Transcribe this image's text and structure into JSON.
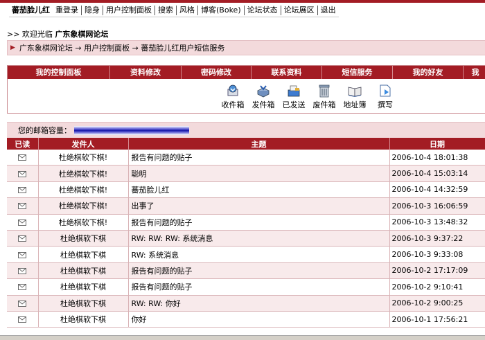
{
  "nav": {
    "user": "蕃茄脸儿红",
    "items": [
      "重登录",
      "隐身",
      "用户控制面板",
      "搜索",
      "风格",
      "博客(Boke)",
      "论坛状态",
      "论坛展区",
      "退出"
    ]
  },
  "welcome": {
    "prefix": ">> 欢迎光临",
    "forum": "广东象棋网论坛"
  },
  "breadcrumb": "广东象棋网论坛 → 用户控制面板 → 蕃茄脸儿红用户短信服务",
  "menu": [
    "我的控制面板",
    "资料修改",
    "密码修改",
    "联系资料",
    "短信服务",
    "我的好友",
    "我"
  ],
  "tools": [
    {
      "label": "收件箱",
      "icon": "inbox-icon"
    },
    {
      "label": "发件箱",
      "icon": "outbox-icon"
    },
    {
      "label": "已发送",
      "icon": "sent-icon"
    },
    {
      "label": "废件箱",
      "icon": "trash-icon"
    },
    {
      "label": "地址簿",
      "icon": "address-book-icon"
    },
    {
      "label": "撰写",
      "icon": "compose-icon"
    }
  ],
  "quota_label": "您的邮箱容量：",
  "table": {
    "headers": [
      "已读",
      "发件人",
      "主题",
      "日期"
    ],
    "rows": [
      {
        "from": "杜绝棋软下棋!",
        "subject": "报告有问题的贴子",
        "date": "2006-10-4 18:01:38"
      },
      {
        "from": "杜绝棋软下棋!",
        "subject": "聪明",
        "date": "2006-10-4 15:03:14"
      },
      {
        "from": "杜绝棋软下棋!",
        "subject": "蕃茄脸儿红",
        "date": "2006-10-4 14:32:59"
      },
      {
        "from": "杜绝棋软下棋!",
        "subject": "出事了",
        "date": "2006-10-3 16:06:59"
      },
      {
        "from": "杜绝棋软下棋!",
        "subject": "报告有问题的贴子",
        "date": "2006-10-3 13:48:32"
      },
      {
        "from": "杜绝棋软下棋",
        "subject": "RW: RW: RW: 系统消息",
        "date": "2006-10-3 9:37:22"
      },
      {
        "from": "杜绝棋软下棋",
        "subject": "RW: 系统消息",
        "date": "2006-10-3 9:33:08"
      },
      {
        "from": "杜绝棋软下棋",
        "subject": "报告有问题的贴子",
        "date": "2006-10-2 17:17:09"
      },
      {
        "from": "杜绝棋软下棋",
        "subject": "报告有问题的贴子",
        "date": "2006-10-2 9:10:41"
      },
      {
        "from": "杜绝棋软下棋",
        "subject": "RW: RW: 你好",
        "date": "2006-10-2 9:00:25"
      },
      {
        "from": "杜绝棋软下棋",
        "subject": "你好",
        "date": "2006-10-1 17:56:21"
      }
    ]
  }
}
